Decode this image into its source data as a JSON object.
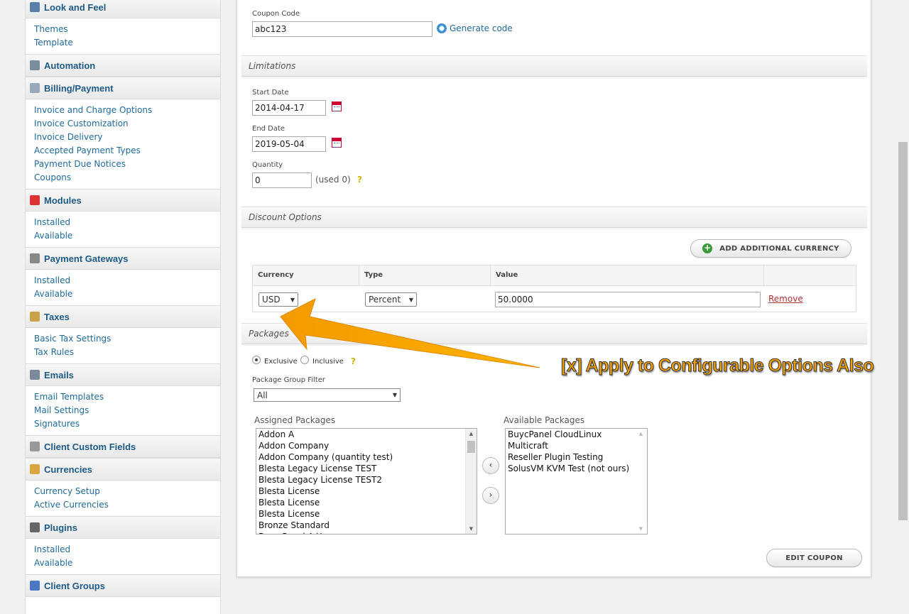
{
  "sidebar": {
    "sections": [
      {
        "title": "Look and Feel",
        "icon": "look-feel-icon",
        "links": [
          "Themes",
          "Template"
        ]
      },
      {
        "title": "Automation",
        "icon": "clock-icon",
        "links": []
      },
      {
        "title": "Billing/Payment",
        "icon": "document-icon",
        "links": [
          "Invoice and Charge Options",
          "Invoice Customization",
          "Invoice Delivery",
          "Accepted Payment Types",
          "Payment Due Notices",
          "Coupons"
        ]
      },
      {
        "title": "Modules",
        "icon": "blocks-icon",
        "links": [
          "Installed",
          "Available"
        ]
      },
      {
        "title": "Payment Gateways",
        "icon": "bank-icon",
        "links": [
          "Installed",
          "Available"
        ]
      },
      {
        "title": "Taxes",
        "icon": "money-icon",
        "links": [
          "Basic Tax Settings",
          "Tax Rules"
        ]
      },
      {
        "title": "Emails",
        "icon": "mail-icon",
        "links": [
          "Email Templates",
          "Mail Settings",
          "Signatures"
        ]
      },
      {
        "title": "Client Custom Fields",
        "icon": "form-icon",
        "links": []
      },
      {
        "title": "Currencies",
        "icon": "currency-icon",
        "links": [
          "Currency Setup",
          "Active Currencies"
        ]
      },
      {
        "title": "Plugins",
        "icon": "plug-icon",
        "links": [
          "Installed",
          "Available"
        ]
      },
      {
        "title": "Client Groups",
        "icon": "group-icon",
        "links": []
      }
    ]
  },
  "coupon": {
    "code_label": "Coupon Code",
    "code_value": "abc123",
    "generate_label": "Generate code"
  },
  "limitations": {
    "title": "Limitations",
    "start_label": "Start Date",
    "start_value": "2014-04-17",
    "end_label": "End Date",
    "end_value": "2019-05-04",
    "quantity_label": "Quantity",
    "quantity_value": "0",
    "used_text": "(used 0)",
    "help": "?"
  },
  "discount": {
    "title": "Discount Options",
    "add_currency_label": "ADD ADDITIONAL CURRENCY",
    "headers": [
      "Currency",
      "Type",
      "Value"
    ],
    "currency": "USD",
    "type": "Percent",
    "value": "50.0000",
    "remove_label": "Remove"
  },
  "packages": {
    "title": "Packages",
    "exclusive_label": "Exclusive",
    "inclusive_label": "Inclusive",
    "help": "?",
    "group_filter_label": "Package Group Filter",
    "group_filter_value": "All",
    "assigned_label": "Assigned Packages",
    "assigned": [
      "Addon A",
      "Addon Company",
      "Addon Company (quantity test)",
      "Blesta Legacy License TEST",
      "Blesta Legacy License TEST2",
      "Blesta License",
      "Blesta License",
      "Blesta License",
      "Bronze Standard",
      "Buy cPanel A Year"
    ],
    "available_label": "Available Packages",
    "available": [
      "BuycPanel CloudLinux",
      "Multicraft",
      "Reseller Plugin Testing",
      "SolusVM KVM Test (not ours)"
    ],
    "move_left": "‹",
    "move_right": "›",
    "submit_label": "EDIT COUPON"
  },
  "annotation": {
    "text": "[x] Apply to Configurable Options Also",
    "color": "#f7a100"
  }
}
